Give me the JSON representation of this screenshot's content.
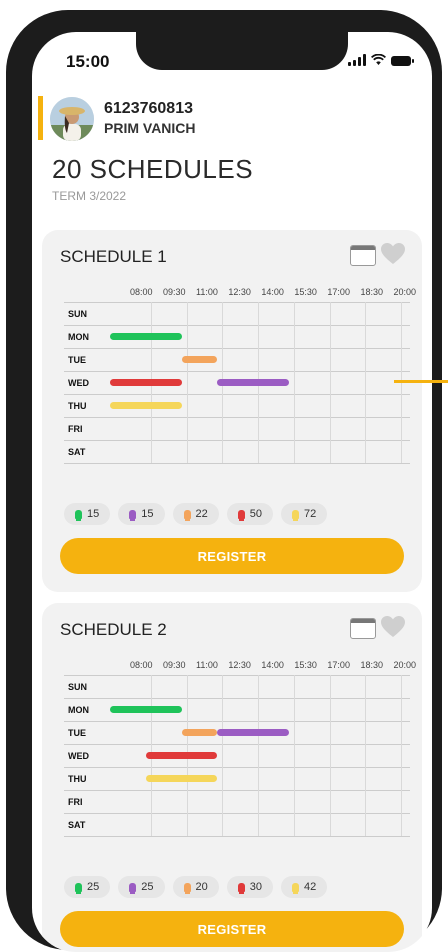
{
  "status_bar": {
    "time": "15:00"
  },
  "user": {
    "id": "6123760813",
    "name": "PRIM VANICH"
  },
  "header": {
    "title": "20 SCHEDULES",
    "term": "TERM 3/2022"
  },
  "time_slots": [
    "08:00",
    "09:30",
    "11:00",
    "12:30",
    "14:00",
    "15:30",
    "17:00",
    "18:30",
    "20:00"
  ],
  "days": [
    "SUN",
    "MON",
    "TUE",
    "WED",
    "THU",
    "FRI",
    "SAT"
  ],
  "colors": {
    "accent": "#f5b20f",
    "green": "#1fc35a",
    "purple": "#9b5cc3",
    "orange": "#f3a45c",
    "red": "#e03a3a",
    "yellow": "#f5d65a"
  },
  "schedules": [
    {
      "title": "SCHEDULE 1",
      "register_label": "REGISTER",
      "classes": [
        {
          "day": "MON",
          "start": "08:00",
          "end": "11:00",
          "color": "green"
        },
        {
          "day": "TUE",
          "start": "11:00",
          "end": "12:30",
          "color": "orange"
        },
        {
          "day": "WED",
          "start": "08:00",
          "end": "11:00",
          "color": "red"
        },
        {
          "day": "WED",
          "start": "12:30",
          "end": "15:30",
          "color": "purple"
        },
        {
          "day": "THU",
          "start": "08:00",
          "end": "11:00",
          "color": "yellow"
        }
      ],
      "seats": [
        {
          "color": "green",
          "count": "15"
        },
        {
          "color": "purple",
          "count": "15"
        },
        {
          "color": "orange",
          "count": "22"
        },
        {
          "color": "red",
          "count": "50"
        },
        {
          "color": "yellow",
          "count": "72"
        }
      ]
    },
    {
      "title": "SCHEDULE 2",
      "register_label": "REGISTER",
      "classes": [
        {
          "day": "MON",
          "start": "08:00",
          "end": "11:00",
          "color": "green"
        },
        {
          "day": "TUE",
          "start": "11:00",
          "end": "12:30",
          "color": "orange"
        },
        {
          "day": "TUE",
          "start": "12:30",
          "end": "15:30",
          "color": "purple"
        },
        {
          "day": "WED",
          "start": "09:30",
          "end": "12:30",
          "color": "red"
        },
        {
          "day": "THU",
          "start": "09:30",
          "end": "12:30",
          "color": "yellow"
        }
      ],
      "seats": [
        {
          "color": "green",
          "count": "25"
        },
        {
          "color": "purple",
          "count": "25"
        },
        {
          "color": "orange",
          "count": "20"
        },
        {
          "color": "red",
          "count": "30"
        },
        {
          "color": "yellow",
          "count": "42"
        }
      ]
    }
  ]
}
